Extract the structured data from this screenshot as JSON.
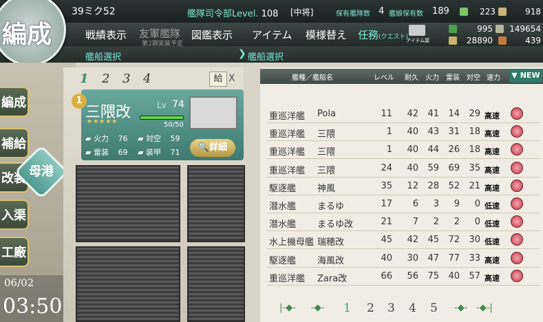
{
  "header": {
    "emblem": "編成",
    "admiral_name": "39ミク52",
    "hq_level_label": "艦隊司令部Level.",
    "hq_level": "108",
    "rank": "[中将]",
    "ship_count_label": "保有艦隊数",
    "fleet_count": "4",
    "ship_owned_label": "艦娘保有数",
    "ship_owned": "189",
    "bucket": "223",
    "dev_material": "918",
    "fuel": "995",
    "ammo": "149654",
    "steel": "28890",
    "bauxite": "439"
  },
  "menu": {
    "items": [
      {
        "label": "戦績表示"
      },
      {
        "label": "友軍艦隊",
        "sub": "第2期実装予定"
      },
      {
        "label": "図鑑表示"
      },
      {
        "label": "アイテム"
      },
      {
        "label": "模様替え"
      },
      {
        "label": "任務",
        "sub": "(クエスト)"
      }
    ],
    "item_shop": "アイテム屋"
  },
  "subbar": {
    "left_title": "艦船選択",
    "right_title": "艦船選択"
  },
  "side": {
    "buttons": [
      "編成",
      "補給",
      "改装",
      "入渠",
      "工廠"
    ],
    "port": "母港",
    "date": "06/02",
    "time": "03:50"
  },
  "fleet": {
    "tabs": [
      "1",
      "2",
      "3",
      "4"
    ],
    "supply_label": "給",
    "close": "X",
    "slot_no": "1",
    "ship": {
      "name": "三隈改",
      "lv_label": "Lv",
      "level": "74",
      "stars": "★★★★★",
      "hp": "50/50",
      "hp_fraction": 1.0,
      "firepower_label": "火力",
      "firepower": "76",
      "aa_label": "対空",
      "aa": "59",
      "torpedo_label": "雷装",
      "torpedo": "69",
      "armor_label": "装甲",
      "armor": "71",
      "detail_label": "詳細"
    }
  },
  "list": {
    "headers": {
      "type_name": "艦種／艦船名",
      "level": "レベル",
      "hp": "耐久",
      "fire": "火力",
      "torpedo": "雷装",
      "aa": "対空",
      "speed": "速力"
    },
    "sort_button": "NEW",
    "rows": [
      {
        "type": "重巡洋艦",
        "name": "Pola",
        "lv": "11",
        "hp": "42",
        "fire": "41",
        "torp": "14",
        "aa": "29",
        "speed": "高速"
      },
      {
        "type": "重巡洋艦",
        "name": "三隈",
        "lv": "1",
        "hp": "40",
        "fire": "43",
        "torp": "31",
        "aa": "18",
        "speed": "高速"
      },
      {
        "type": "重巡洋艦",
        "name": "三隈",
        "lv": "1",
        "hp": "40",
        "fire": "44",
        "torp": "26",
        "aa": "18",
        "speed": "高速"
      },
      {
        "type": "重巡洋艦",
        "name": "三隈",
        "lv": "24",
        "hp": "40",
        "fire": "59",
        "torp": "69",
        "aa": "35",
        "speed": "高速"
      },
      {
        "type": "駆逐艦",
        "name": "神風",
        "lv": "35",
        "hp": "12",
        "fire": "28",
        "torp": "52",
        "aa": "21",
        "speed": "高速"
      },
      {
        "type": "潜水艦",
        "name": "まるゆ",
        "lv": "17",
        "hp": "6",
        "fire": "3",
        "torp": "9",
        "aa": "0",
        "speed": "低速"
      },
      {
        "type": "潜水艦",
        "name": "まるゆ改",
        "lv": "21",
        "hp": "7",
        "fire": "2",
        "torp": "2",
        "aa": "0",
        "speed": "低速"
      },
      {
        "type": "水上機母艦",
        "name": "瑞穂改",
        "lv": "45",
        "hp": "42",
        "fire": "45",
        "torp": "72",
        "aa": "30",
        "speed": "低速"
      },
      {
        "type": "駆逐艦",
        "name": "海風改",
        "lv": "40",
        "hp": "30",
        "fire": "47",
        "torp": "77",
        "aa": "33",
        "speed": "高速"
      },
      {
        "type": "重巡洋艦",
        "name": "Zara改",
        "lv": "66",
        "hp": "56",
        "fire": "75",
        "torp": "40",
        "aa": "57",
        "speed": "高速"
      }
    ],
    "pages": [
      "1",
      "2",
      "3",
      "4",
      "5"
    ],
    "current_page": "1",
    "first_arrow": "|-◆-",
    "prev_arrow": "-◆-",
    "next_arrow": "-◆-",
    "last_arrow": "-◆-|"
  },
  "colors": {
    "accent": "#3aa070",
    "menu_bg": "#2a3432",
    "card": "#4e8a80"
  }
}
